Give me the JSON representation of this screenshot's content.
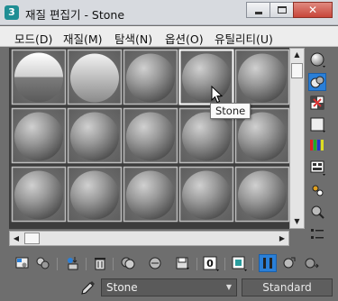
{
  "window": {
    "app_icon_text": "3",
    "title": "재질 편집기 - Stone",
    "minimize_label": "",
    "close_glyph": "✕"
  },
  "menu": [
    {
      "label": "모드(D)"
    },
    {
      "label": "재질(M)"
    },
    {
      "label": "탐색(N)"
    },
    {
      "label": "옵션(O)"
    },
    {
      "label": "유틸리티(U)"
    }
  ],
  "sample_slots": {
    "rows": 3,
    "columns": 5,
    "selected_index": 3,
    "active_index": 0,
    "sphere_color": "#8f8f8f"
  },
  "tooltip": {
    "text": "Stone"
  },
  "scroll": {
    "up": "▲",
    "down": "▼",
    "left": "◀",
    "right": "▶"
  },
  "side_toolbar": [
    {
      "icon": "sample-type-sphere-icon"
    },
    {
      "icon": "backlight-icon",
      "active": true
    },
    {
      "icon": "background-checker-icon"
    },
    {
      "icon": "uv-tiling-icon"
    },
    {
      "icon": "video-color-check-icon"
    },
    {
      "icon": "make-preview-icon"
    },
    {
      "icon": "options-icon"
    },
    {
      "icon": "select-by-material-icon"
    },
    {
      "icon": "material-navigator-icon"
    }
  ],
  "bottom_toolbar": [
    {
      "icon": "get-material-icon"
    },
    {
      "icon": "put-material-to-scene-icon"
    },
    {
      "icon": "assign-material-icon"
    },
    {
      "icon": "reset-map-icon"
    },
    {
      "icon": "copy-material-icon"
    },
    {
      "icon": "make-unique-icon"
    },
    {
      "icon": "put-to-library-icon"
    },
    {
      "icon": "material-id-channel-icon",
      "text": "0"
    },
    {
      "icon": "show-shaded-material-icon"
    },
    {
      "icon": "show-end-result-icon"
    },
    {
      "icon": "go-to-parent-icon"
    },
    {
      "icon": "go-forward-sibling-icon"
    }
  ],
  "name_row": {
    "material_name": "Stone",
    "dropdown_glyph": "▼",
    "type_button_label": "Standard"
  },
  "colors": {
    "titlebar": "#d7dadf",
    "menubar": "#ededed",
    "panel_background": "#6e6e6e",
    "slot_border": "#bdbdbd",
    "selected_border": "#ffffff",
    "accent_blue": "#2a7fd8"
  }
}
